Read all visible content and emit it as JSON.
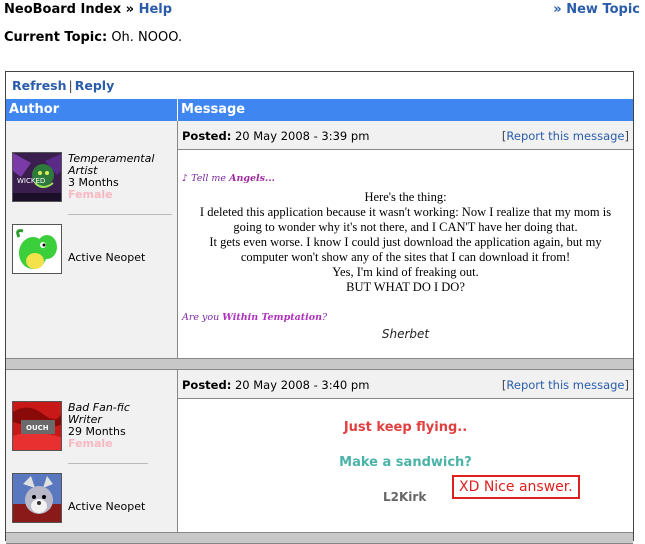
{
  "breadcrumb": {
    "root": "NeoBoard Index",
    "sep": "»",
    "current": "Help"
  },
  "new_topic": {
    "arrow": "»",
    "label": "New Topic"
  },
  "current_topic": {
    "label": "Current Topic:",
    "value": "Oh. NOOO."
  },
  "actions": {
    "refresh": "Refresh",
    "sep": "|",
    "reply": "Reply"
  },
  "table_header": {
    "author": "Author",
    "message": "Message"
  },
  "posts": [
    {
      "author": {
        "title_line1": "Temperamental",
        "title_line2": "Artist",
        "age": "3 Months",
        "gender": "Female",
        "avatar_text": "WICKED"
      },
      "pet_label": "Active Neopet",
      "posted_label": "Posted:",
      "posted_time": "20 May 2008 - 3:39 pm",
      "report": "Report this message",
      "sig_top_prefix": "Tell me",
      "sig_top_big": "Angels...",
      "body_lines": [
        "Here's the thing:",
        "I deleted this application because it wasn't working: Now I realize that my mom is",
        "going to wonder why it's not there, and I CAN'T have her doing that.",
        "It gets even worse. I know I could just download the application again, but my",
        "computer won't show any of the sites that I can download it from!",
        "Yes, I'm kind of freaking out.",
        "BUT WHAT DO I DO?"
      ],
      "sig_bottom_prefix": "Are you",
      "sig_bottom_big": "Within Temptation",
      "sig_bottom_suffix": "?",
      "signature_name": "Sherbet"
    },
    {
      "author": {
        "title_line1": "Bad Fan-fic",
        "title_line2": "Writer",
        "age": "29 Months",
        "gender": "Female",
        "avatar_text": "OUCH"
      },
      "pet_label": "Active Neopet",
      "posted_label": "Posted:",
      "posted_time": "20 May 2008 - 3:40 pm",
      "report": "Report this message",
      "line1": "Just keep flying..",
      "line2": "Make a sandwich?",
      "signature_name": "L2Kirk",
      "overlay_note": "XD Nice answer."
    }
  ],
  "colors": {
    "header_bg": "#3f86f0",
    "link": "#2a5caa",
    "female": "#f7b8c2",
    "overlay": "#e02020"
  }
}
